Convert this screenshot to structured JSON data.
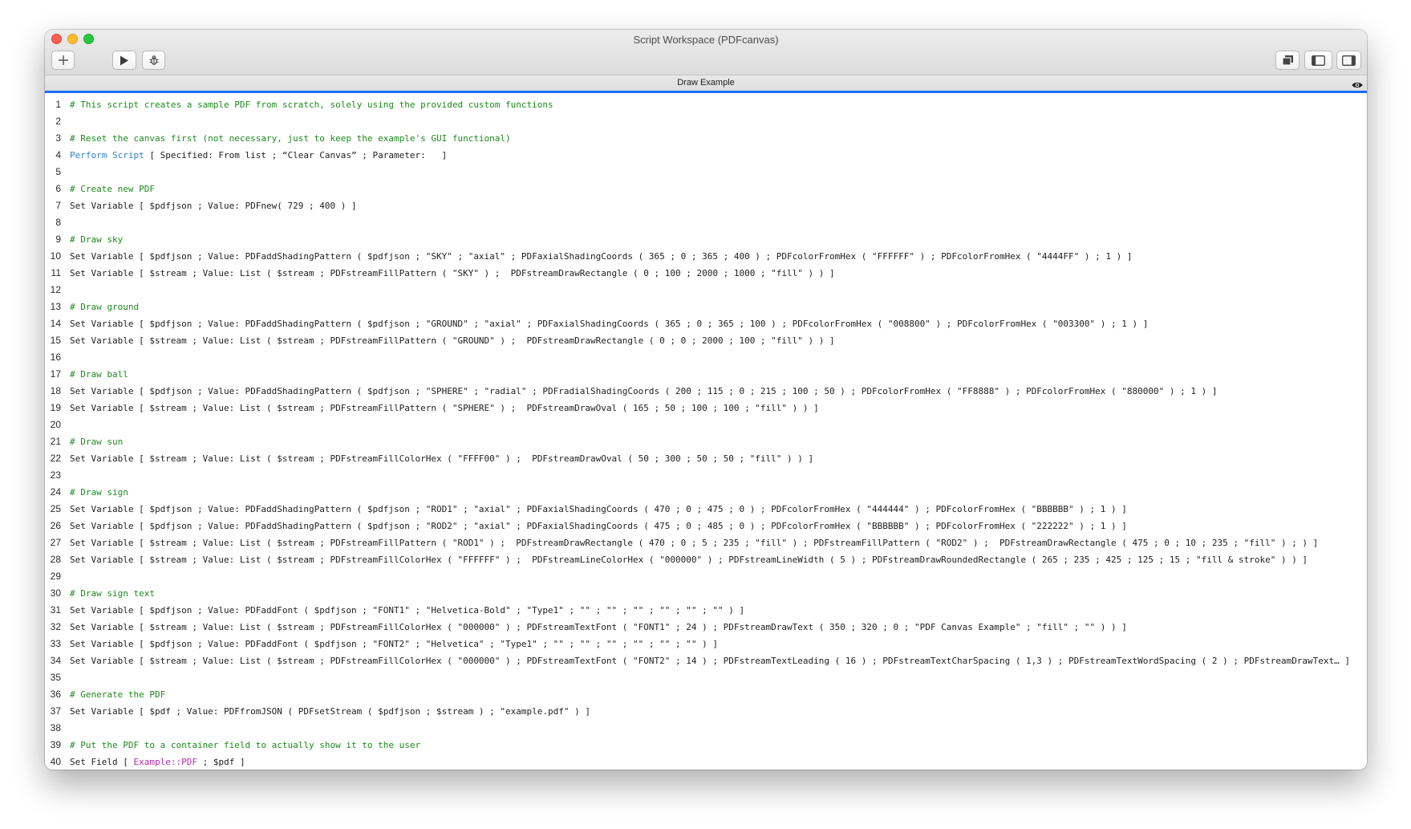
{
  "window": {
    "title": "Script Workspace (PDFcanvas)",
    "tab_title": "Draw Example"
  },
  "toolbar": {
    "icons": [
      "plus-icon",
      "play-icon",
      "bug-icon",
      "duplicate-icon",
      "sidebar-left-icon",
      "sidebar-right-icon"
    ]
  },
  "colors": {
    "comment": "#1d8a1d",
    "step_keyword": "#2d86c8",
    "field_reference": "#b12fb1",
    "accent": "#1a6ef5"
  },
  "lines": [
    {
      "n": "1",
      "parts": [
        {
          "t": "# This script creates a sample PDF from scratch, solely using the provided custom functions",
          "c": "cmt"
        }
      ]
    },
    {
      "n": "2",
      "parts": []
    },
    {
      "n": "3",
      "parts": [
        {
          "t": "# Reset the canvas first (not necessary, just to keep the example's GUI functional)",
          "c": "cmt"
        }
      ]
    },
    {
      "n": "4",
      "parts": [
        {
          "t": "Perform Script",
          "c": "kw"
        },
        {
          "t": " [ Specified: From list ; “Clear Canvas” ; Parameter:   ]",
          "c": ""
        }
      ]
    },
    {
      "n": "5",
      "parts": []
    },
    {
      "n": "6",
      "parts": [
        {
          "t": "# Create new PDF",
          "c": "cmt"
        }
      ]
    },
    {
      "n": "7",
      "parts": [
        {
          "t": "Set Variable [ $pdfjson ; Value: PDFnew( 729 ; 400 ) ]",
          "c": ""
        }
      ]
    },
    {
      "n": "8",
      "parts": []
    },
    {
      "n": "9",
      "parts": [
        {
          "t": "# Draw sky",
          "c": "cmt"
        }
      ]
    },
    {
      "n": "10",
      "parts": [
        {
          "t": "Set Variable [ $pdfjson ; Value: PDFaddShadingPattern ( $pdfjson ; \"SKY\" ; \"axial\" ; PDFaxialShadingCoords ( 365 ; 0 ; 365 ; 400 ) ; PDFcolorFromHex ( \"FFFFFF\" ) ; PDFcolorFromHex ( \"4444FF\" ) ; 1 ) ]",
          "c": ""
        }
      ]
    },
    {
      "n": "11",
      "parts": [
        {
          "t": "Set Variable [ $stream ; Value: List ( $stream ; PDFstreamFillPattern ( \"SKY\" ) ;  PDFstreamDrawRectangle ( 0 ; 100 ; 2000 ; 1000 ; \"fill\" ) ) ]",
          "c": ""
        }
      ]
    },
    {
      "n": "12",
      "parts": []
    },
    {
      "n": "13",
      "parts": [
        {
          "t": "# Draw ground",
          "c": "cmt"
        }
      ]
    },
    {
      "n": "14",
      "parts": [
        {
          "t": "Set Variable [ $pdfjson ; Value: PDFaddShadingPattern ( $pdfjson ; \"GROUND\" ; \"axial\" ; PDFaxialShadingCoords ( 365 ; 0 ; 365 ; 100 ) ; PDFcolorFromHex ( \"008800\" ) ; PDFcolorFromHex ( \"003300\" ) ; 1 ) ]",
          "c": ""
        }
      ]
    },
    {
      "n": "15",
      "parts": [
        {
          "t": "Set Variable [ $stream ; Value: List ( $stream ; PDFstreamFillPattern ( \"GROUND\" ) ;  PDFstreamDrawRectangle ( 0 ; 0 ; 2000 ; 100 ; \"fill\" ) ) ]",
          "c": ""
        }
      ]
    },
    {
      "n": "16",
      "parts": []
    },
    {
      "n": "17",
      "parts": [
        {
          "t": "# Draw ball",
          "c": "cmt"
        }
      ]
    },
    {
      "n": "18",
      "parts": [
        {
          "t": "Set Variable [ $pdfjson ; Value: PDFaddShadingPattern ( $pdfjson ; \"SPHERE\" ; \"radial\" ; PDFradialShadingCoords ( 200 ; 115 ; 0 ; 215 ; 100 ; 50 ) ; PDFcolorFromHex ( \"FF8888\" ) ; PDFcolorFromHex ( \"880000\" ) ; 1 ) ]",
          "c": ""
        }
      ]
    },
    {
      "n": "19",
      "parts": [
        {
          "t": "Set Variable [ $stream ; Value: List ( $stream ; PDFstreamFillPattern ( \"SPHERE\" ) ;  PDFstreamDrawOval ( 165 ; 50 ; 100 ; 100 ; \"fill\" ) ) ]",
          "c": ""
        }
      ]
    },
    {
      "n": "20",
      "parts": []
    },
    {
      "n": "21",
      "parts": [
        {
          "t": "# Draw sun",
          "c": "cmt"
        }
      ]
    },
    {
      "n": "22",
      "parts": [
        {
          "t": "Set Variable [ $stream ; Value: List ( $stream ; PDFstreamFillColorHex ( \"FFFF00\" ) ;  PDFstreamDrawOval ( 50 ; 300 ; 50 ; 50 ; \"fill\" ) ) ]",
          "c": ""
        }
      ]
    },
    {
      "n": "23",
      "parts": []
    },
    {
      "n": "24",
      "parts": [
        {
          "t": "# Draw sign",
          "c": "cmt"
        }
      ]
    },
    {
      "n": "25",
      "parts": [
        {
          "t": "Set Variable [ $pdfjson ; Value: PDFaddShadingPattern ( $pdfjson ; \"ROD1\" ; \"axial\" ; PDFaxialShadingCoords ( 470 ; 0 ; 475 ; 0 ) ; PDFcolorFromHex ( \"444444\" ) ; PDFcolorFromHex ( \"BBBBBB\" ) ; 1 ) ]",
          "c": ""
        }
      ]
    },
    {
      "n": "26",
      "parts": [
        {
          "t": "Set Variable [ $pdfjson ; Value: PDFaddShadingPattern ( $pdfjson ; \"ROD2\" ; \"axial\" ; PDFaxialShadingCoords ( 475 ; 0 ; 485 ; 0 ) ; PDFcolorFromHex ( \"BBBBBB\" ) ; PDFcolorFromHex ( \"222222\" ) ; 1 ) ]",
          "c": ""
        }
      ]
    },
    {
      "n": "27",
      "parts": [
        {
          "t": "Set Variable [ $stream ; Value: List ( $stream ; PDFstreamFillPattern ( \"ROD1\" ) ;  PDFstreamDrawRectangle ( 470 ; 0 ; 5 ; 235 ; \"fill\" ) ; PDFstreamFillPattern ( \"ROD2\" ) ;  PDFstreamDrawRectangle ( 475 ; 0 ; 10 ; 235 ; \"fill\" ) ; ) ]",
          "c": ""
        }
      ]
    },
    {
      "n": "28",
      "parts": [
        {
          "t": "Set Variable [ $stream ; Value: List ( $stream ; PDFstreamFillColorHex ( \"FFFFFF\" ) ;  PDFstreamLineColorHex ( \"000000\" ) ; PDFstreamLineWidth ( 5 ) ; PDFstreamDrawRoundedRectangle ( 265 ; 235 ; 425 ; 125 ; 15 ; \"fill & stroke\" ) ) ]",
          "c": ""
        }
      ]
    },
    {
      "n": "29",
      "parts": []
    },
    {
      "n": "30",
      "parts": [
        {
          "t": "# Draw sign text",
          "c": "cmt"
        }
      ]
    },
    {
      "n": "31",
      "parts": [
        {
          "t": "Set Variable [ $pdfjson ; Value: PDFaddFont ( $pdfjson ; \"FONT1\" ; \"Helvetica-Bold\" ; \"Type1\" ; \"\" ; \"\" ; \"\" ; \"\" ; \"\" ; \"\" ) ]",
          "c": ""
        }
      ]
    },
    {
      "n": "32",
      "parts": [
        {
          "t": "Set Variable [ $stream ; Value: List ( $stream ; PDFstreamFillColorHex ( \"000000\" ) ; PDFstreamTextFont ( \"FONT1\" ; 24 ) ; PDFstreamDrawText ( 350 ; 320 ; 0 ; \"PDF Canvas Example\" ; \"fill\" ; \"\" ) ) ]",
          "c": ""
        }
      ]
    },
    {
      "n": "33",
      "parts": [
        {
          "t": "Set Variable [ $pdfjson ; Value: PDFaddFont ( $pdfjson ; \"FONT2\" ; \"Helvetica\" ; \"Type1\" ; \"\" ; \"\" ; \"\" ; \"\" ; \"\" ; \"\" ) ]",
          "c": ""
        }
      ]
    },
    {
      "n": "34",
      "parts": [
        {
          "t": "Set Variable [ $stream ; Value: List ( $stream ; PDFstreamFillColorHex ( \"000000\" ) ; PDFstreamTextFont ( \"FONT2\" ; 14 ) ; PDFstreamTextLeading ( 16 ) ; PDFstreamTextCharSpacing ( 1,3 ) ; PDFstreamTextWordSpacing ( 2 ) ; PDFstreamDrawText… ]",
          "c": ""
        }
      ]
    },
    {
      "n": "35",
      "parts": []
    },
    {
      "n": "36",
      "parts": [
        {
          "t": "# Generate the PDF",
          "c": "cmt"
        }
      ]
    },
    {
      "n": "37",
      "parts": [
        {
          "t": "Set Variable [ $pdf ; Value: PDFfromJSON ( PDFsetStream ( $pdfjson ; $stream ) ; \"example.pdf\" ) ]",
          "c": ""
        }
      ]
    },
    {
      "n": "38",
      "parts": []
    },
    {
      "n": "39",
      "parts": [
        {
          "t": "# Put the PDF to a container field to actually show it to the user",
          "c": "cmt"
        }
      ]
    },
    {
      "n": "40",
      "parts": [
        {
          "t": "Set Field [ ",
          "c": ""
        },
        {
          "t": "Example::PDF",
          "c": "fld"
        },
        {
          "t": " ; $pdf ]",
          "c": ""
        }
      ]
    }
  ]
}
